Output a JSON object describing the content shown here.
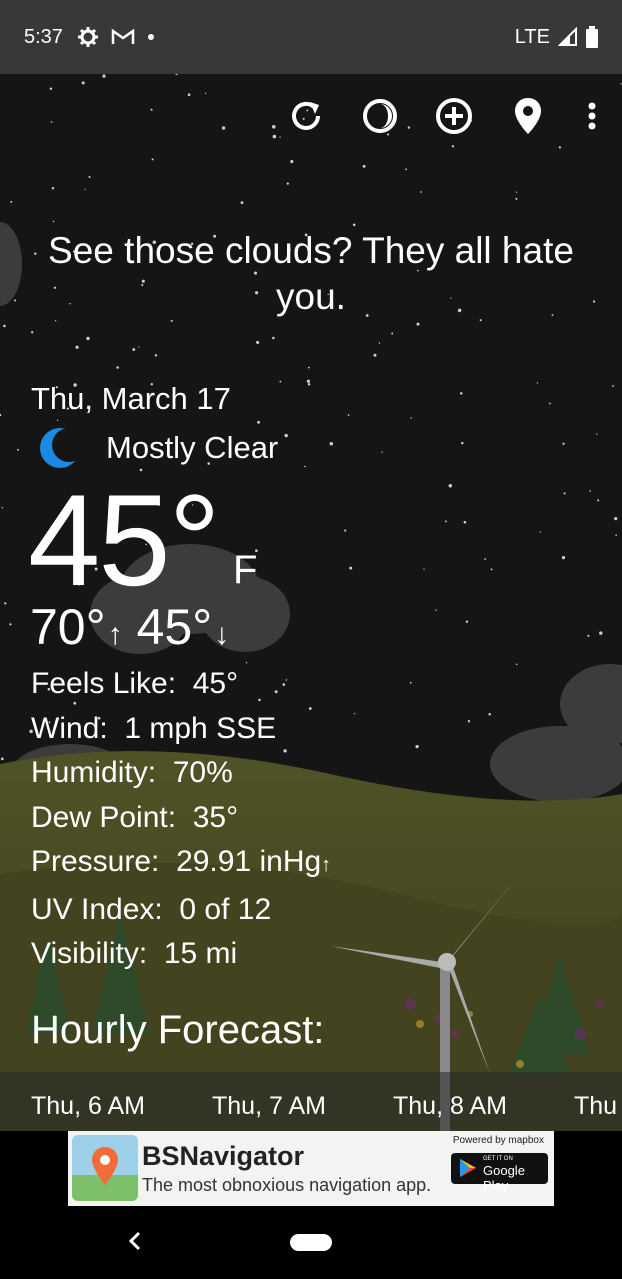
{
  "status_bar": {
    "time": "5:37",
    "network": "LTE"
  },
  "toolbar": {
    "icons": [
      "refresh-icon",
      "theme-icon",
      "add-location-icon",
      "location-pin-icon",
      "more-vert-icon"
    ]
  },
  "quote": "See those clouds? They all hate you.",
  "current": {
    "date": "Thu, March 17",
    "condition": "Mostly Clear",
    "temperature": "45°",
    "unit": "F",
    "high": "70°",
    "low": "45°"
  },
  "details": [
    {
      "label": "Feels Like:",
      "value": "45°"
    },
    {
      "label": "Wind:",
      "value": "1 mph SSE"
    },
    {
      "label": "Humidity:",
      "value": "70%"
    },
    {
      "label": "Dew Point:",
      "value": "35°"
    },
    {
      "label": "Pressure:",
      "value": "29.91 inHg"
    },
    {
      "label": "UV Index:",
      "value": "0 of 12"
    },
    {
      "label": "Visibility:",
      "value": "15 mi"
    }
  ],
  "hourly": {
    "title": "Hourly Forecast:",
    "items": [
      "Thu, 6 AM",
      "Thu, 7 AM",
      "Thu, 8 AM",
      "Thu"
    ]
  },
  "ad": {
    "title": "BSNavigator",
    "subtitle": "The most obnoxious navigation app.",
    "powered_by": "Powered by mapbox",
    "store_small": "GET IT ON",
    "store_big": "Google Play"
  },
  "colors": {
    "accent_blue": "#1e88e5",
    "sky": "#141414",
    "ground": "#4a4a1e"
  }
}
